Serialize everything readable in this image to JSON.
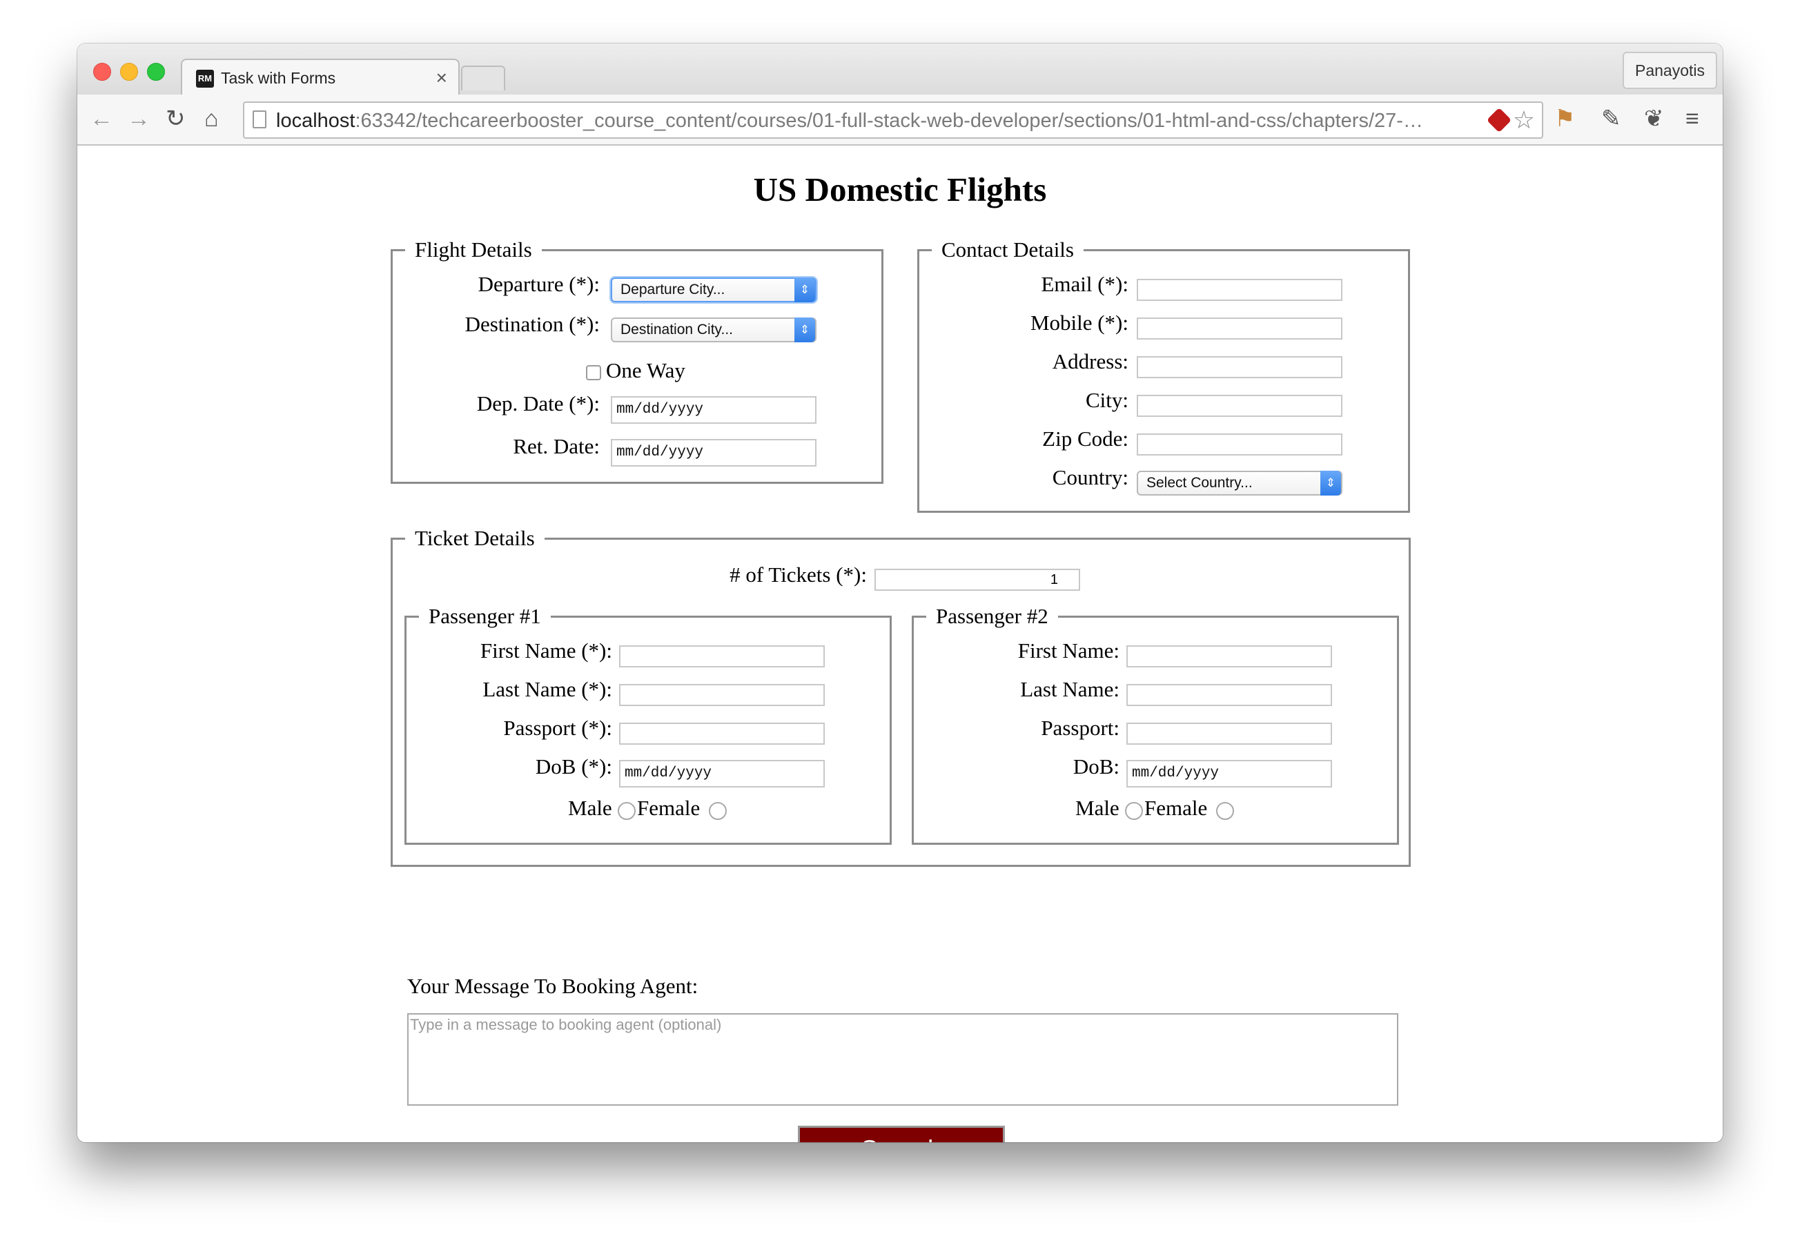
{
  "browser": {
    "tab_title": "Task with Forms",
    "tab_favicon": "RM",
    "tab_close": "×",
    "profile_name": "Panayotis",
    "url_host": "localhost",
    "url_rest": ":63342/techcareerbooster_course_content/courses/01-full-stack-web-developer/sections/01-html-and-css/chapters/27-…",
    "icons": {
      "back": "←",
      "forward": "→",
      "reload": "↻",
      "home": "⌂",
      "star": "☆",
      "flag": "⚑",
      "dropper": "✎",
      "evernote": "❦",
      "menu": "≡"
    }
  },
  "page": {
    "title": "US Domestic Flights",
    "flight_details": {
      "legend": "Flight Details",
      "departure_label": "Departure (*):",
      "departure_value": "Departure City...",
      "destination_label": "Destination (*):",
      "destination_value": "Destination City...",
      "one_way_label": "One Way",
      "dep_date_label": "Dep. Date (*):",
      "ret_date_label": "Ret. Date:",
      "date_placeholder": "mm/dd/yyyy"
    },
    "contact_details": {
      "legend": "Contact Details",
      "email_label": "Email (*):",
      "mobile_label": "Mobile (*):",
      "address_label": "Address:",
      "city_label": "City:",
      "zip_label": "Zip Code:",
      "country_label": "Country:",
      "country_value": "Select Country..."
    },
    "ticket_details": {
      "legend": "Ticket Details",
      "tickets_label": "# of Tickets (*):",
      "tickets_value": "1",
      "passenger1": {
        "legend": "Passenger #1",
        "first_name_label": "First Name (*):",
        "last_name_label": "Last Name (*):",
        "passport_label": "Passport (*):",
        "dob_label": "DoB (*):",
        "male_label": "Male",
        "female_label": "Female"
      },
      "passenger2": {
        "legend": "Passenger #2",
        "first_name_label": "First Name:",
        "last_name_label": "Last Name:",
        "passport_label": "Passport:",
        "dob_label": "DoB:",
        "male_label": "Male",
        "female_label": "Female"
      }
    },
    "message": {
      "label": "Your Message To Booking Agent:",
      "placeholder": "Type in a message to booking agent (optional)"
    },
    "search_label": "Search"
  },
  "colors": {
    "search_button_bg": "#7f0000",
    "select_arrow": "#2f7de8"
  }
}
